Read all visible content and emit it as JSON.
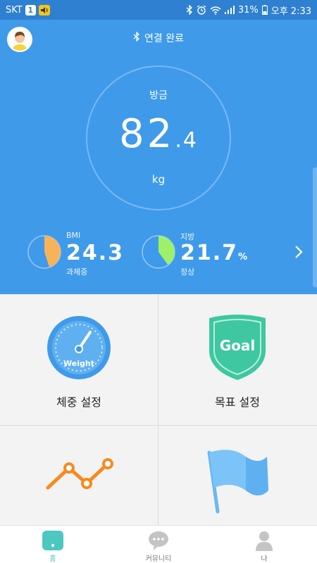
{
  "status": {
    "carrier": "SKT",
    "sim_badge": "1",
    "battery": "31%",
    "time": "오후 2:33"
  },
  "header": {
    "connection": "연결 완료",
    "recent_label": "방금",
    "weight_int": "82",
    "weight_dec": ".4",
    "unit": "kg"
  },
  "stats": {
    "bmi": {
      "label": "BMI",
      "value": "24.3",
      "status": "과체중",
      "fraction": 0.45,
      "color": "#f8b25a"
    },
    "fat": {
      "label": "지방",
      "value": "21.7",
      "unit": "%",
      "status": "정상",
      "fraction": 0.4,
      "color": "#9ef06a"
    }
  },
  "grid": {
    "weight_setting": "체중 설정",
    "goal_setting": "목표 설정",
    "gauge_text": "Weight",
    "shield_text": "Goal"
  },
  "nav": {
    "home": "홈",
    "community": "커뮤니티",
    "me": "나"
  },
  "colors": {
    "primary": "#3f9aea",
    "statusbar": "#2f80d0",
    "teal": "#4cc8c0",
    "orange": "#f58b1f"
  }
}
